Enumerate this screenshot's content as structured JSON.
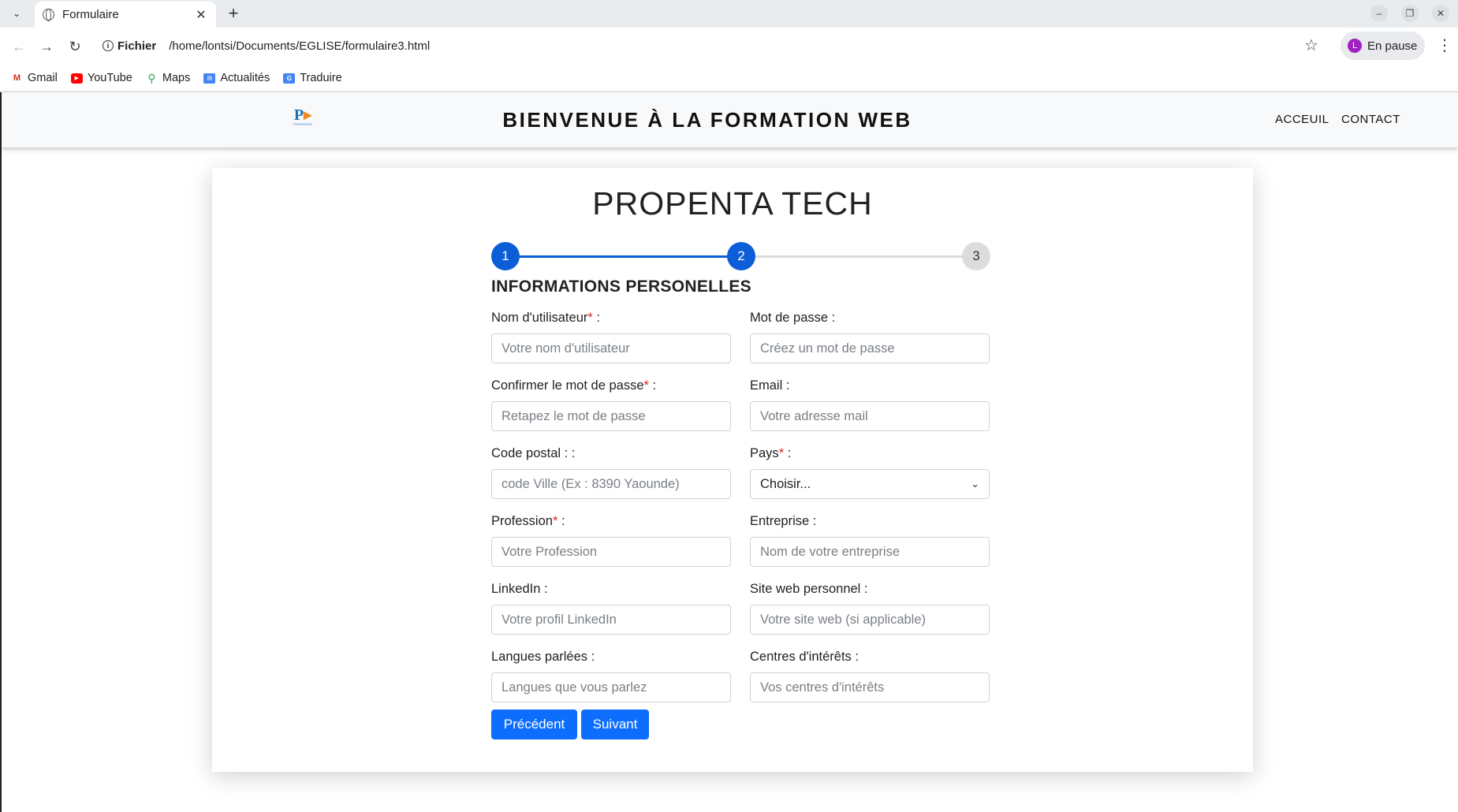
{
  "browser": {
    "tab_title": "Formulaire",
    "new_tab_icon": "+",
    "scheme_label": "Fichier",
    "url": "/home/lontsi/Documents/EGLISE/formulaire3.html",
    "profile_initial": "L",
    "profile_label": "En pause",
    "bookmarks": [
      {
        "label": "Gmail",
        "icon": "gmail-icon"
      },
      {
        "label": "YouTube",
        "icon": "youtube-icon"
      },
      {
        "label": "Maps",
        "icon": "maps-icon"
      },
      {
        "label": "Actualités",
        "icon": "news-icon"
      },
      {
        "label": "Traduire",
        "icon": "translate-icon"
      }
    ]
  },
  "header": {
    "title": "BIENVENUE À LA FORMATION WEB",
    "nav": [
      "ACCEUIL",
      "CONTACT"
    ]
  },
  "form": {
    "title": "PROPENTA TECH",
    "steps": [
      "1",
      "2",
      "3"
    ],
    "current_step": 2,
    "section_title": "INFORMATIONS PERSONELLES",
    "fields": {
      "username": {
        "label": "Nom d'utilisateur",
        "required": "*",
        "suffix": " :",
        "placeholder": "Votre nom d'utilisateur"
      },
      "password": {
        "label": "Mot de passe :",
        "placeholder": "Créez un mot de passe"
      },
      "confirm": {
        "label": "Confirmer le mot de passe",
        "required": "*",
        "suffix": " :",
        "placeholder": "Retapez le mot de passe"
      },
      "email": {
        "label": "Email :",
        "placeholder": "Votre adresse mail"
      },
      "postal": {
        "label": "Code postal : :",
        "placeholder": "code Ville (Ex : 8390 Yaounde)"
      },
      "country": {
        "label": "Pays",
        "required": "*",
        "suffix": " :",
        "selected": "Choisir..."
      },
      "profession": {
        "label": "Profession",
        "required": "*",
        "suffix": " :",
        "placeholder": "Votre Profession"
      },
      "company": {
        "label": "Entreprise :",
        "placeholder": "Nom de votre entreprise"
      },
      "linkedin": {
        "label": "LinkedIn :",
        "placeholder": "Votre profil LinkedIn"
      },
      "website": {
        "label": "Site web personnel :",
        "placeholder": "Votre site web (si applicable)"
      },
      "languages": {
        "label": "Langues parlées :",
        "placeholder": "Langues que vous parlez"
      },
      "interests": {
        "label": "Centres d'intérêts :",
        "placeholder": "Vos centres d'intérêts"
      }
    },
    "buttons": {
      "previous": "Précédent",
      "next": "Suivant"
    }
  },
  "colors": {
    "primary": "#0d6efd",
    "step_active": "#0b5ed7",
    "step_inactive": "#dcdcdc",
    "required": "#e0261b"
  }
}
